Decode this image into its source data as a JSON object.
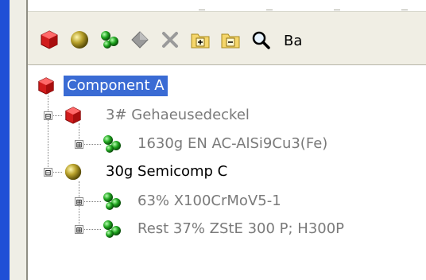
{
  "toolbar": {
    "buttons": [
      {
        "icon": "red-cube-icon"
      },
      {
        "icon": "gold-sphere-icon"
      },
      {
        "icon": "green-spheres-icon"
      },
      {
        "icon": "gray-diamond-icon"
      },
      {
        "icon": "delete-x-icon"
      },
      {
        "icon": "expand-folder-icon"
      },
      {
        "icon": "collapse-folder-icon"
      },
      {
        "icon": "search-icon"
      }
    ],
    "cut_label": "Ba"
  },
  "tree": {
    "root": {
      "label": "Component A",
      "icon": "red-cube-icon",
      "selected": true
    },
    "nodes": [
      {
        "label": "3# Gehaeusedeckel",
        "icon": "red-cube-icon",
        "expander": "⊟",
        "style": "gray"
      },
      {
        "label": "1630g EN AC-AlSi9Cu3(Fe)",
        "icon": "green-spheres-icon",
        "expander": "⊞",
        "style": "gray"
      },
      {
        "label": "30g Semicomp C",
        "icon": "gold-sphere-icon",
        "expander": "⊟",
        "style": "black"
      },
      {
        "label": "63% X100CrMoV5-1",
        "icon": "green-spheres-icon",
        "expander": "⊞",
        "style": "gray"
      },
      {
        "label": "Rest 37% ZStE 300 P; H300P",
        "icon": "green-spheres-icon",
        "expander": "⊞",
        "style": "gray"
      }
    ]
  }
}
